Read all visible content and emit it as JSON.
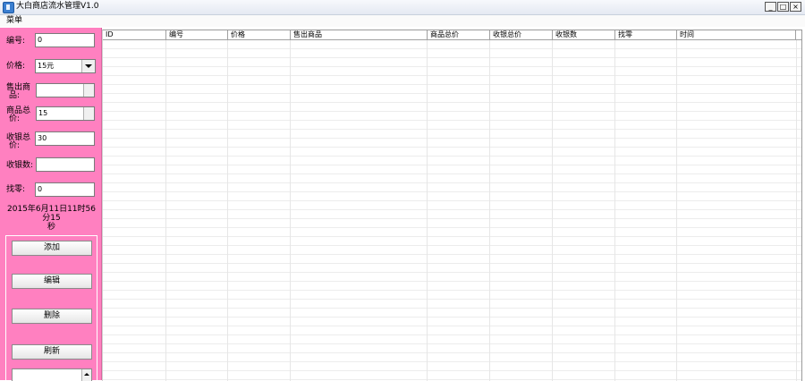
{
  "window": {
    "title": "大白商店流水管理V1.0",
    "min_icon": "_",
    "max_icon": "□",
    "close_icon": "×"
  },
  "menu": {
    "items": [
      "菜单"
    ]
  },
  "form": {
    "id_label": "编号:",
    "id_value": "0",
    "price_label": "价格:",
    "price_value": "15元",
    "sold_label_1": "售出商",
    "sold_label_2": "品:",
    "sold_value": "",
    "total_label_1": "商品总",
    "total_label_2": "价:",
    "total_value": "15",
    "received_total_label_1": "收银总",
    "received_total_label_2": "价:",
    "received_total_value": "30",
    "received_label": "收银数:",
    "received_value": "",
    "change_label": "找零:",
    "change_value": "0"
  },
  "datetime": {
    "line1": "2015年6月11日11时56分15",
    "line2": "秒"
  },
  "buttons": {
    "add": "添加",
    "edit": "编辑",
    "delete": "删除",
    "refresh": "刷新"
  },
  "table": {
    "columns": [
      "ID",
      "编号",
      "价格",
      "售出商品",
      "商品总价",
      "收银总价",
      "收银数",
      "找零",
      "时间"
    ],
    "rows": []
  }
}
